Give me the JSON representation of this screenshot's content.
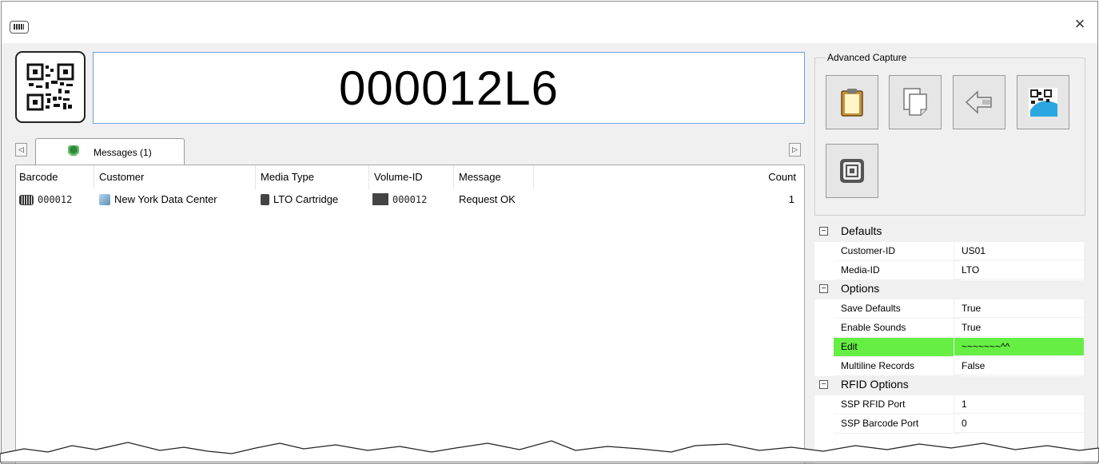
{
  "window": {
    "app_icon": "barcode-scanner-icon",
    "close_glyph": "×"
  },
  "barcode": {
    "value": "000012L6",
    "scan_button_icon": "qr-code-icon"
  },
  "tabs": {
    "scroll_left": "◁",
    "scroll_right": "▷",
    "items": [
      {
        "label": "Messages (1)",
        "icon": "messages-tab-icon"
      }
    ]
  },
  "messages": {
    "columns": [
      "Barcode",
      "Customer",
      "Media Type",
      "Volume-ID",
      "Message",
      "Count"
    ],
    "rows": [
      {
        "barcode": "000012",
        "customer": "New York Data Center",
        "media_type": "LTO Cartridge",
        "volume_id": "000012",
        "message": "Request OK",
        "count": "1"
      }
    ]
  },
  "advanced_capture": {
    "title": "Advanced Capture",
    "buttons": [
      {
        "icon": "clipboard-icon"
      },
      {
        "icon": "copy-pages-icon"
      },
      {
        "icon": "back-arrow-icon"
      },
      {
        "icon": "qr-capture-icon"
      },
      {
        "icon": "rfid-chip-icon"
      }
    ]
  },
  "properties": {
    "highlight_color": "#66ee44",
    "categories": [
      {
        "name": "Defaults",
        "items": [
          {
            "name": "Customer-ID",
            "value": "US01"
          },
          {
            "name": "Media-ID",
            "value": "LTO"
          }
        ]
      },
      {
        "name": "Options",
        "items": [
          {
            "name": "Save Defaults",
            "value": "True"
          },
          {
            "name": "Enable Sounds",
            "value": "True"
          },
          {
            "name": "Edit",
            "value": "~~~~~~~^^"
          },
          {
            "name": "Multiline Records",
            "value": "False"
          }
        ]
      },
      {
        "name": "RFID Options",
        "items": [
          {
            "name": "SSP RFID Port",
            "value": "1"
          },
          {
            "name": "SSP Barcode Port",
            "value": "0"
          }
        ]
      }
    ]
  }
}
